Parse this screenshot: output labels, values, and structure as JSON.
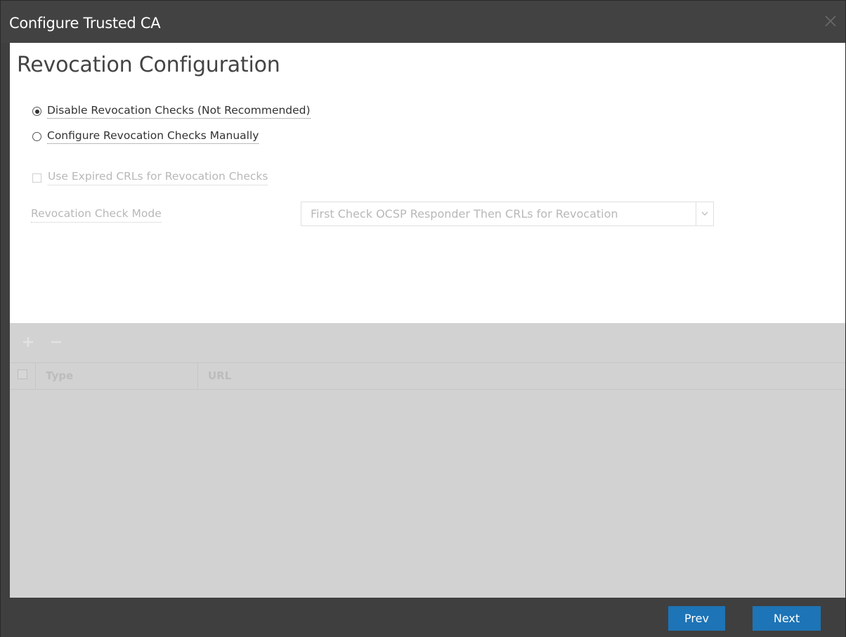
{
  "dialog": {
    "title": "Configure Trusted CA"
  },
  "page": {
    "heading": "Revocation Configuration"
  },
  "options": {
    "disable_label": "Disable Revocation Checks (Not Recommended)",
    "manual_label": "Configure Revocation Checks Manually",
    "selected": "disable"
  },
  "settings": {
    "use_expired_crls_label": "Use Expired CRLs for Revocation Checks",
    "use_expired_crls_checked": false,
    "check_mode_label": "Revocation Check Mode",
    "check_mode_value": "First Check OCSP Responder Then CRLs for Revocation"
  },
  "table": {
    "columns": [
      "Type",
      "URL"
    ],
    "rows": []
  },
  "footer": {
    "prev_label": "Prev",
    "next_label": "Next"
  },
  "colors": {
    "titlebar": "#424242",
    "button": "#1d74b6",
    "disabled_text": "#b8b8b8",
    "disabled_area": "#d2d2d2"
  },
  "icons": {
    "close": "close-icon",
    "add": "plus-icon",
    "remove": "minus-icon",
    "dropdown": "chevron-down-icon"
  }
}
